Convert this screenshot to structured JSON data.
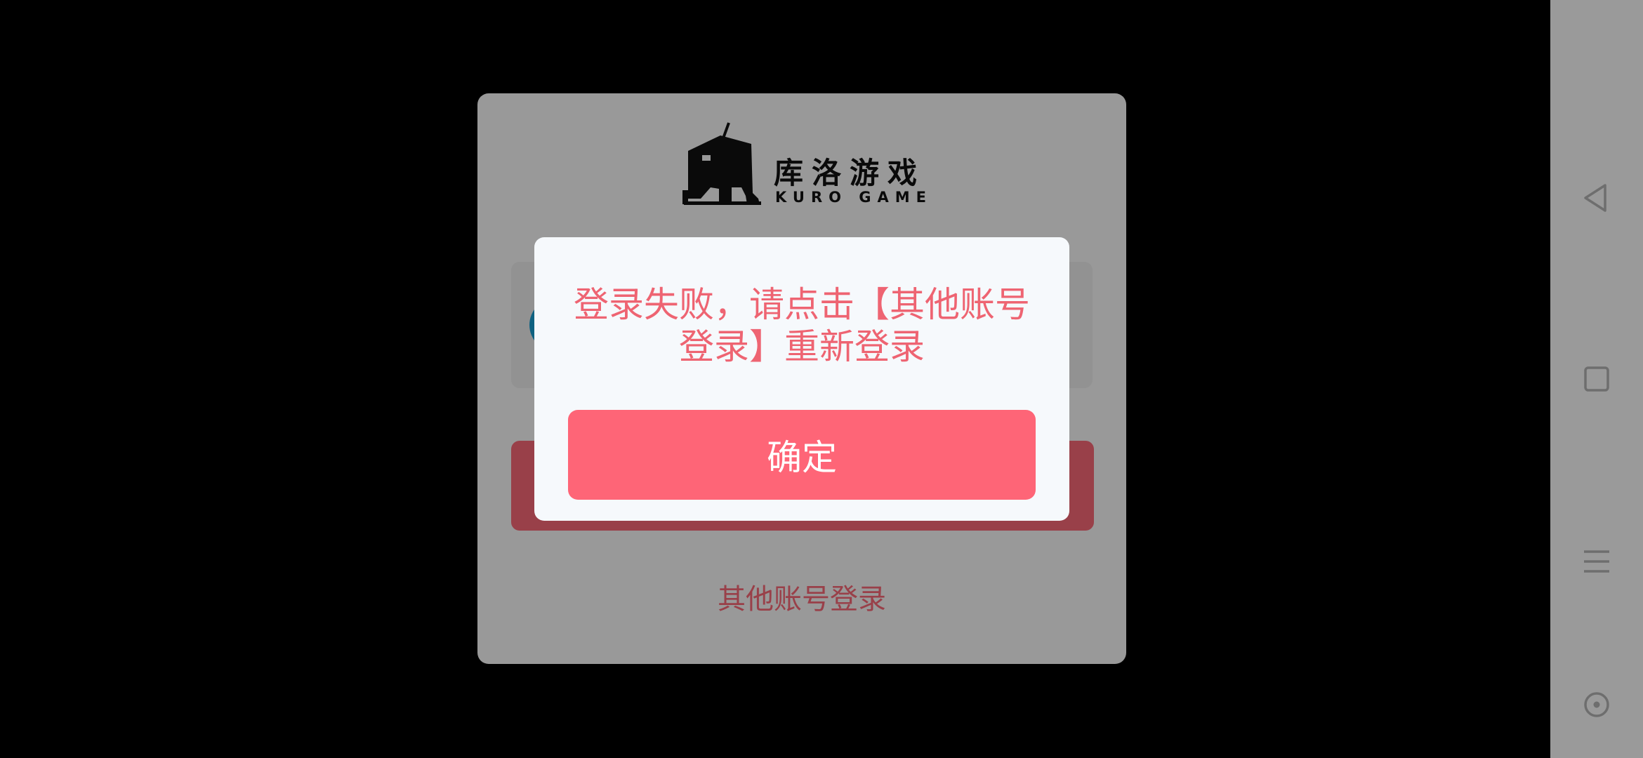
{
  "background_panel": {
    "brand_cn": "库洛游戏",
    "brand_en": "KURO GAME",
    "other_login_label": "其他账号登录"
  },
  "dialog": {
    "message": "登录失败，请点击【其他账号登录】重新登录",
    "confirm_label": "确定"
  },
  "nav_bar": {
    "back_icon": "back-triangle-icon",
    "home_icon": "home-square-icon",
    "menu_icon": "menu-lines-icon",
    "assist_icon": "assist-circle-icon"
  },
  "colors": {
    "accent": "#fe6577",
    "dialog_text": "#ee6472",
    "nav_bar": "#9a9a9a"
  }
}
